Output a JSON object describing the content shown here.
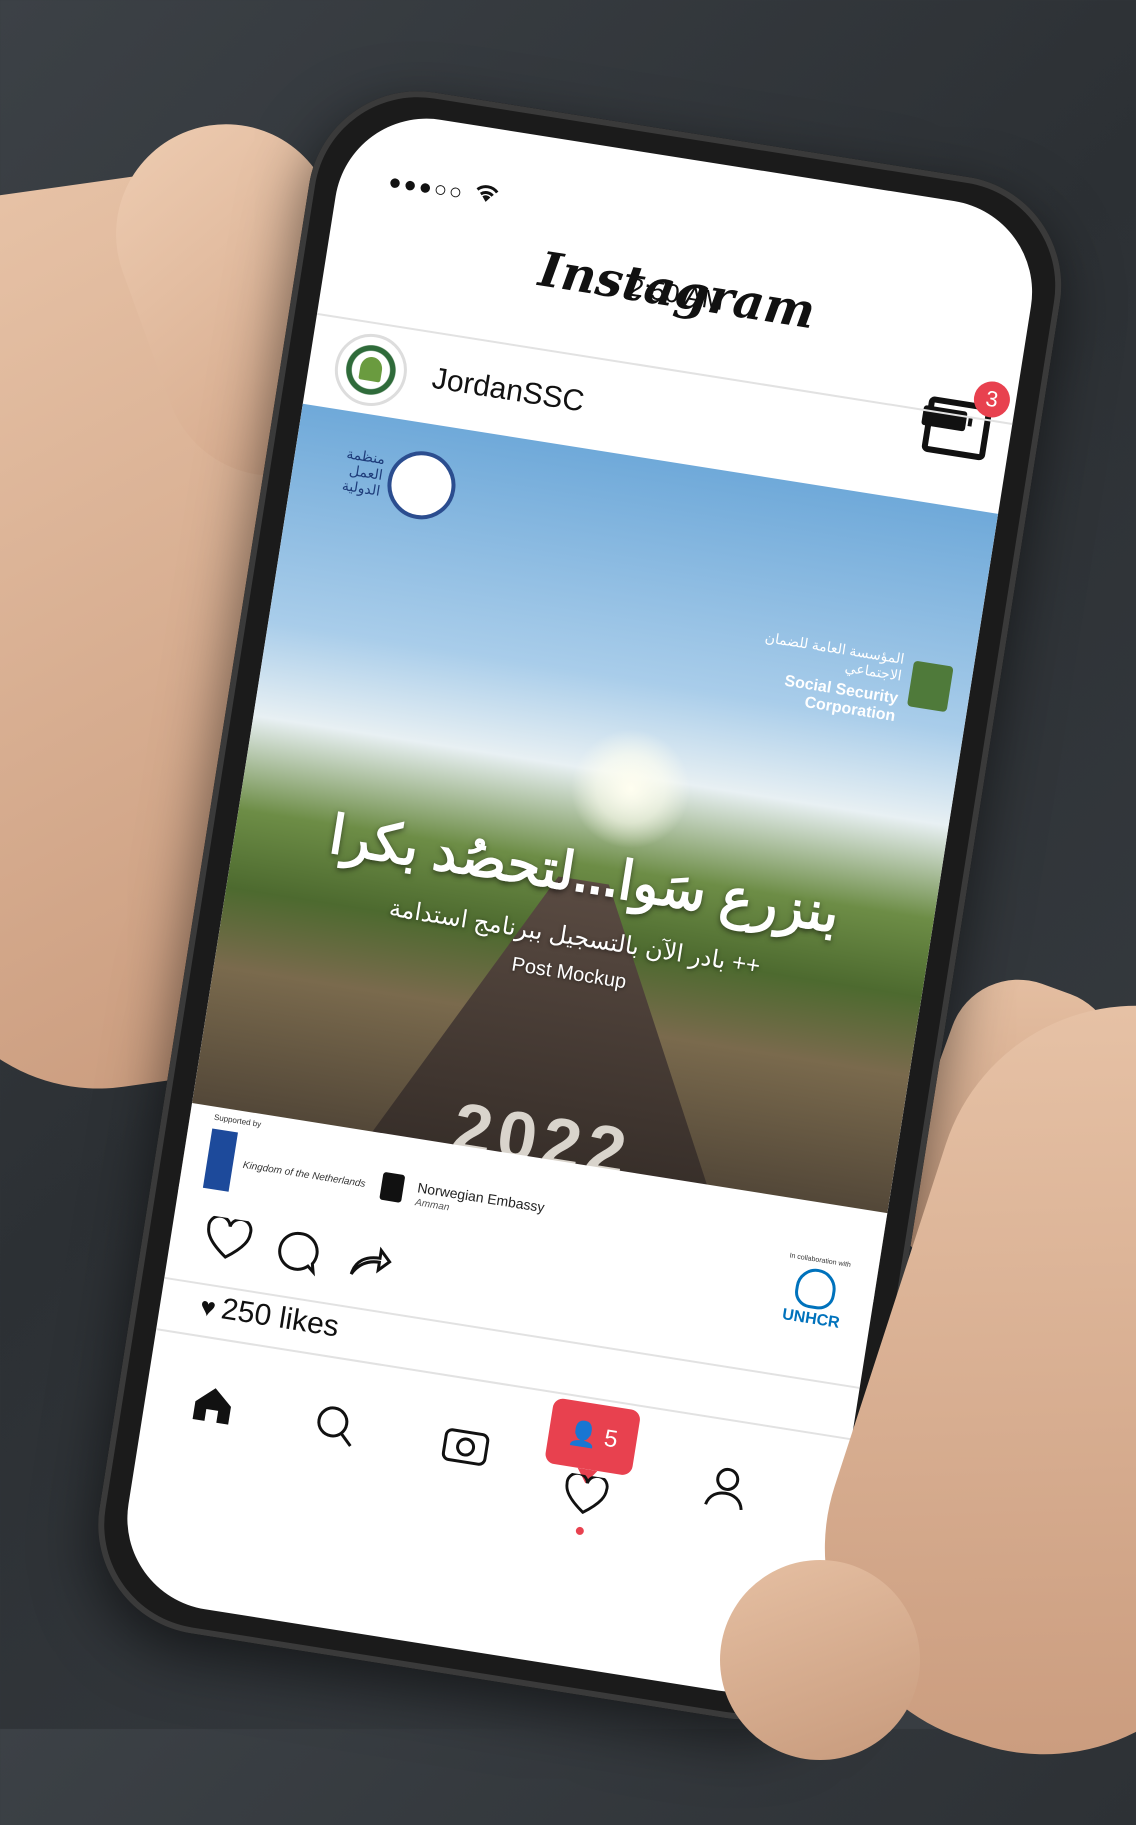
{
  "status_bar": {
    "signal": "●●●○○",
    "wifi_icon": "wifi-icon",
    "time": "2:50 AM"
  },
  "header": {
    "app_title": "Instagram",
    "inbox_badge": "3"
  },
  "post": {
    "username": "JordanSSC",
    "more_label": "•••",
    "image": {
      "ilo_text": "منظمة العمل الدولية",
      "ssc_arabic": "المؤسسة العامة للضمان الاجتماعي",
      "ssc_english": "Social Security Corporation",
      "headline": "بنزرع سَوا...لتحصُد بكرا",
      "subline": "بادر الآن بالتسجيل ببرنامج استدامة ++",
      "watermark": "Post Mockup",
      "road_years": "2022",
      "sponsor_label": "Supported by",
      "netherlands": "Kingdom of the Netherlands",
      "norway": "Norwegian Embassy",
      "norway_sub": "Amman",
      "collab_label": "In collaboration with",
      "unhcr": "UNHCR"
    },
    "likes": "250 likes"
  },
  "bottom_nav": {
    "notifications_count": "5"
  }
}
